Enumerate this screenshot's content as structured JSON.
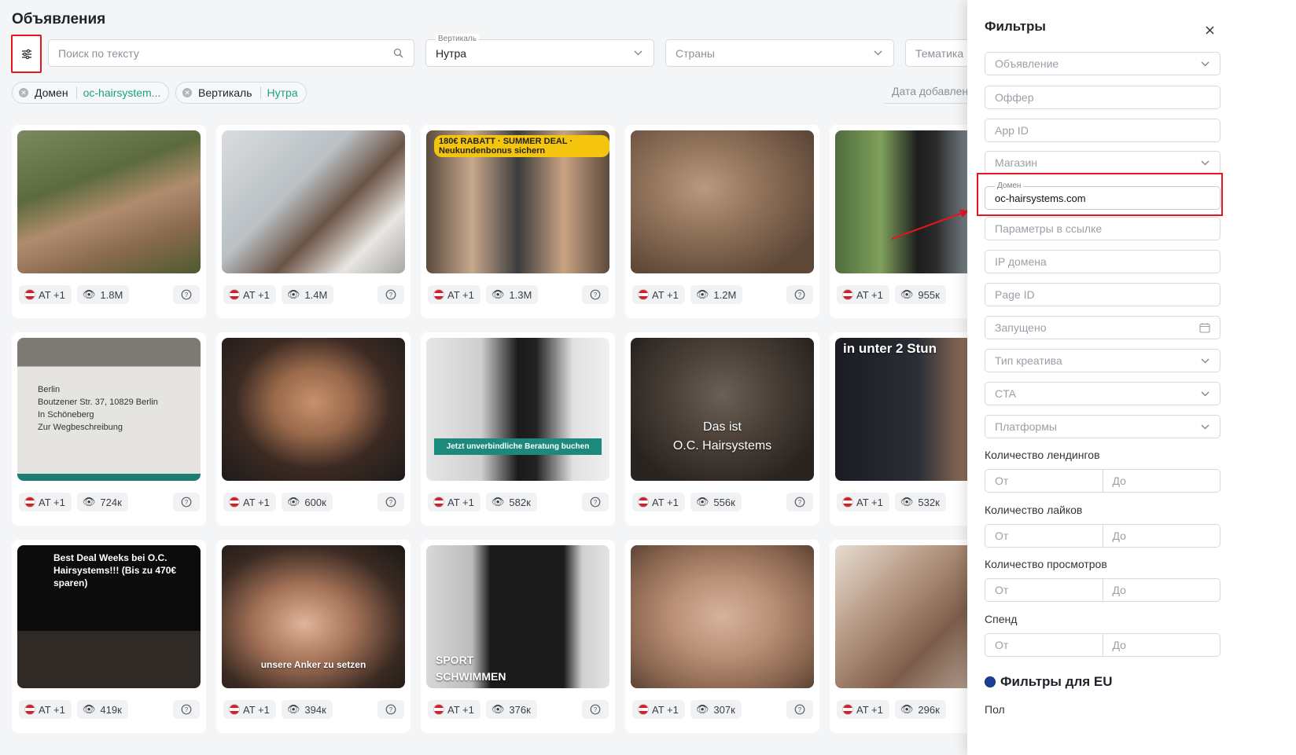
{
  "page": {
    "title": "Объявления",
    "search_placeholder": "Поиск по тексту",
    "vertical_label": "Вертикаль",
    "vertical_value": "Нутра",
    "countries_placeholder": "Страны",
    "topic_placeholder": "Тематика",
    "sort_label": "Дата добавлени"
  },
  "active_filters": [
    {
      "key": "Домен",
      "value": "oc-hairsystem..."
    },
    {
      "key": "Вертикаль",
      "value": "Нутра"
    }
  ],
  "cards": [
    {
      "geo": "AT +1",
      "views": "1.8M",
      "text": ""
    },
    {
      "geo": "AT +1",
      "views": "1.4M",
      "text": ""
    },
    {
      "geo": "AT +1",
      "views": "1.3M",
      "text": "180€ RABATT · SUMMER DEAL · Neukundenbonus sichern"
    },
    {
      "geo": "AT +1",
      "views": "1.2M",
      "text": ""
    },
    {
      "geo": "AT +1",
      "views": "955к",
      "text": ""
    },
    {
      "geo": "AT +1",
      "views": "724к",
      "text": "Berlin\nBoutzener Str. 37, 10829 Berlin\nIn Schöneberg\nZur Wegbeschreibung"
    },
    {
      "geo": "AT +1",
      "views": "600к",
      "text": ""
    },
    {
      "geo": "AT +1",
      "views": "582к",
      "text": "Jetzt unverbindliche Beratung buchen"
    },
    {
      "geo": "AT +1",
      "views": "556к",
      "text": "Das ist\nO.C. Hairsystems"
    },
    {
      "geo": "AT +1",
      "views": "532к",
      "text": "in unter 2 Stun"
    },
    {
      "geo": "AT +1",
      "views": "419к",
      "text": "Best Deal Weeks bei O.C. Hairsystems!!! (Bis zu 470€ sparen)"
    },
    {
      "geo": "AT +1",
      "views": "394к",
      "text": "unsere Anker zu setzen"
    },
    {
      "geo": "AT +1",
      "views": "376к",
      "text": "SPORT\nSCHWIMMEN"
    },
    {
      "geo": "AT +1",
      "views": "307к",
      "text": ""
    },
    {
      "geo": "AT +1",
      "views": "296к",
      "text": ""
    }
  ],
  "panel": {
    "title": "Фильтры",
    "ad": "Объявление",
    "offer": "Оффер",
    "app_id": "App ID",
    "store": "Магазин",
    "domain_label": "Домен",
    "domain_value": "oc-hairsystems.com",
    "link_params": "Параметры в ссылке",
    "domain_ip": "IP домена",
    "page_id": "Page ID",
    "launched": "Запущено",
    "creative_type": "Тип креатива",
    "cta": "CTA",
    "platforms": "Платформы",
    "landings_label": "Количество лендингов",
    "likes_label": "Количество лайков",
    "views_label": "Количество просмотров",
    "spend_label": "Спенд",
    "from": "От",
    "to": "До",
    "eu_title": "Фильтры для EU",
    "gender_label": "Пол"
  },
  "colors": {
    "highlight": "#e8141e",
    "chip_value": "#1aa37a"
  }
}
